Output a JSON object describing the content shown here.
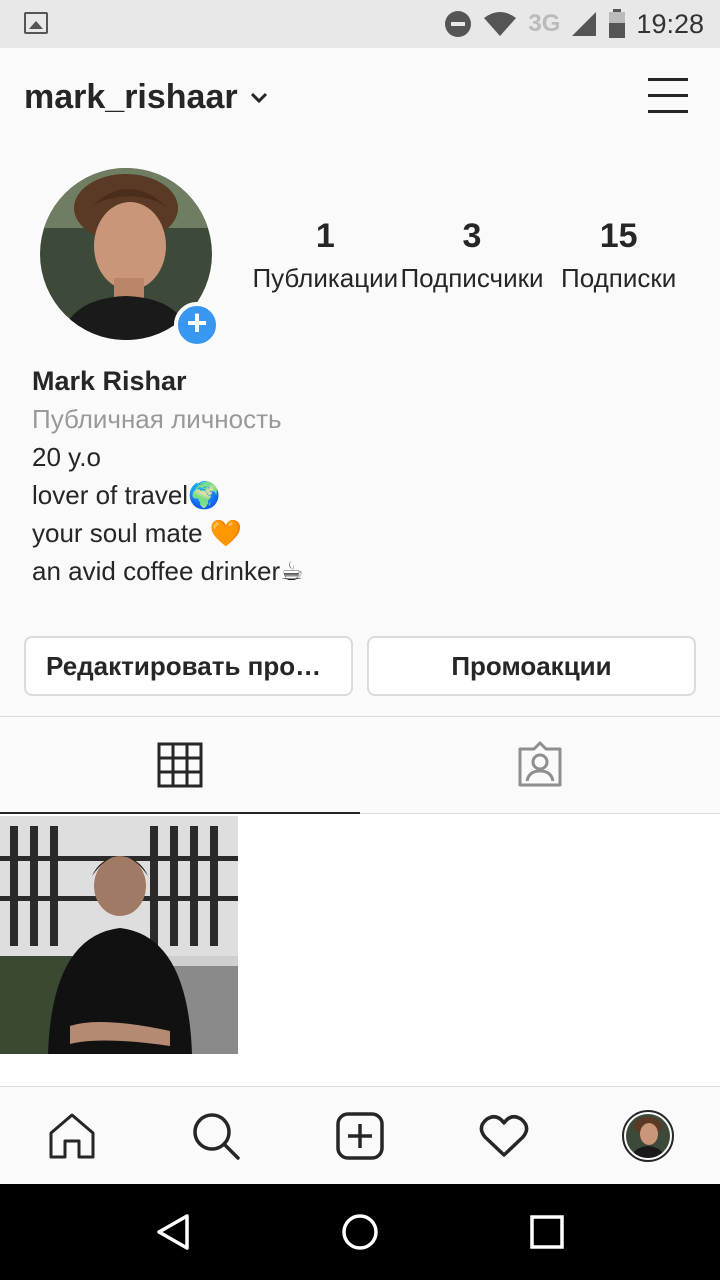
{
  "status_bar": {
    "time": "19:28",
    "network": "3G"
  },
  "header": {
    "username": "mark_rishaar"
  },
  "profile": {
    "stats": [
      {
        "value": "1",
        "label": "Публикации"
      },
      {
        "value": "3",
        "label": "Подписчики"
      },
      {
        "value": "15",
        "label": "Подписки"
      }
    ],
    "name": "Mark Rishar",
    "category": "Публичная личность",
    "bio_lines": [
      "20 y.o",
      "lover of travel🌍",
      "your soul mate 🧡",
      "an avid coffee drinker☕"
    ]
  },
  "buttons": {
    "edit_profile": "Редактировать профиль",
    "promotions": "Промоакции"
  },
  "colors": {
    "accent": "#3897f0",
    "text": "#262626",
    "muted": "#999999",
    "border": "#dbdbdb"
  },
  "icons": [
    "image-icon",
    "dnd-icon",
    "wifi-icon",
    "signal-icon",
    "battery-icon",
    "chevron-down-icon",
    "hamburger-menu-icon",
    "plus-icon",
    "grid-icon",
    "tagged-icon",
    "home-icon",
    "search-icon",
    "add-post-icon",
    "heart-icon",
    "back-icon",
    "home-circle-icon",
    "recents-icon"
  ]
}
